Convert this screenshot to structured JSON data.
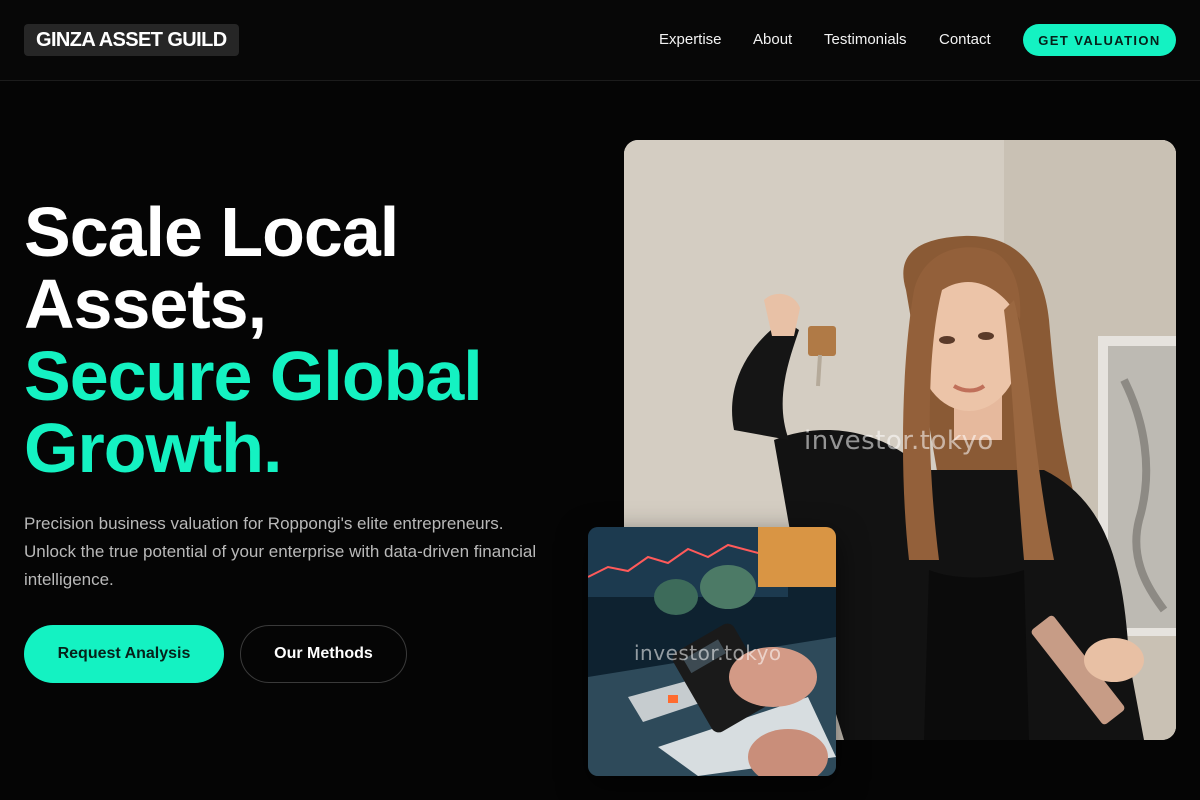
{
  "brand": {
    "logo_text": "GINZA ASSET GUILD"
  },
  "nav": {
    "items": [
      {
        "label": "Expertise"
      },
      {
        "label": "About"
      },
      {
        "label": "Testimonials"
      },
      {
        "label": "Contact"
      }
    ],
    "cta_label": "GET VALUATION"
  },
  "hero": {
    "headline_lines": [
      "Scale Local",
      "Assets,",
      "Secure Global",
      "Growth."
    ],
    "subcopy": "Precision business valuation for Roppongi's elite entrepreneurs. Unlock the true potential of your enterprise with data-driven financial intelligence.",
    "primary_cta": "Request Analysis",
    "secondary_cta": "Our Methods"
  },
  "images": {
    "main_watermark": "investor.tokyo",
    "secondary_watermark": "investor.tokyo"
  },
  "colors": {
    "accent": "#14f2c2",
    "background": "#050505",
    "muted_text": "#b9b9b9"
  }
}
